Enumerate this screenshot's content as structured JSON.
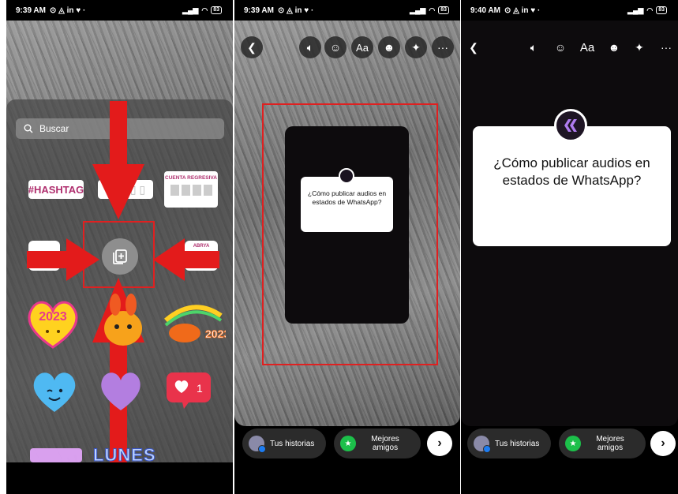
{
  "panel1": {
    "status": {
      "time": "9:39 AM",
      "indicators": "⊙ ◬ in ♥ ·",
      "battery": "83"
    },
    "search": {
      "placeholder": "Buscar"
    },
    "stickers": {
      "hashtag": "#HASHTAG",
      "countdown": "CUENTA REGRESIVA",
      "right_tile": "ABRYA",
      "year": "2023",
      "like_count": "1",
      "weekday": "LUNES"
    }
  },
  "panel2": {
    "status": {
      "time": "9:39 AM",
      "indicators": "⊙ ◬ in ♥ ·",
      "battery": "83"
    },
    "toolbar": {
      "text_tool": "Aa"
    },
    "question": "¿Cómo publicar audios en estados de WhatsApp?",
    "bottom": {
      "your_story": "Tus historias",
      "close_friends": "Mejores amigos"
    }
  },
  "panel3": {
    "status": {
      "time": "9:40 AM",
      "indicators": "⊙ ◬ in ♥ ·",
      "battery": "83"
    },
    "toolbar": {
      "text_tool": "Aa"
    },
    "question": "¿Cómo publicar audios en estados de WhatsApp?",
    "bottom": {
      "your_story": "Tus historias",
      "close_friends": "Mejores amigos"
    }
  },
  "colors": {
    "highlight": "#e02020",
    "accent_green": "#1cc04a",
    "sticker_pink": "#b0306f"
  }
}
